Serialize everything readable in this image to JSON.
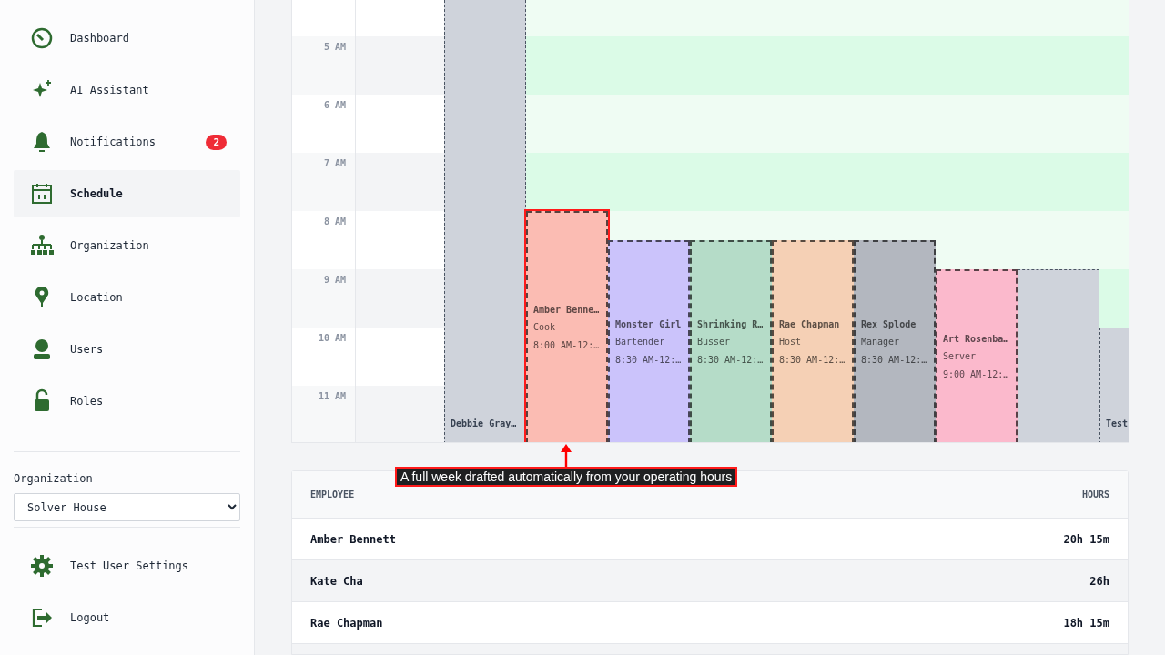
{
  "sidebar": {
    "items": [
      {
        "label": "Dashboard",
        "selected": false
      },
      {
        "label": "AI Assistant",
        "selected": false
      },
      {
        "label": "Notifications",
        "selected": false,
        "badge": "2"
      },
      {
        "label": "Schedule",
        "selected": true
      },
      {
        "label": "Organization",
        "selected": false
      },
      {
        "label": "Location",
        "selected": false
      },
      {
        "label": "Users",
        "selected": false
      },
      {
        "label": "Roles",
        "selected": false
      }
    ],
    "organization": {
      "label": "Organization",
      "value": "Solver House"
    },
    "footer_items": [
      {
        "label": "Test User Settings"
      },
      {
        "label": "Logout"
      }
    ]
  },
  "calendar": {
    "hours": [
      "5 AM",
      "6 AM",
      "7 AM",
      "8 AM",
      "9 AM",
      "10 AM",
      "11 AM"
    ],
    "events": [
      {
        "kind": "time-off",
        "name": "Debbie Gray…",
        "highlighted": false
      },
      {
        "kind": "shift",
        "name": "Amber Benne…",
        "role": "Cook",
        "time": "8:00 AM-12:…",
        "color": "#fbbcb3",
        "highlighted": true
      },
      {
        "kind": "shift",
        "name": "Monster Girl",
        "role": "Bartender",
        "time": "8:30 AM-12:…",
        "color": "#cbc3fb",
        "highlighted": false
      },
      {
        "kind": "shift",
        "name": "Shrinking R…",
        "role": "Busser",
        "time": "8:30 AM-12:…",
        "color": "#b5dcc8",
        "highlighted": false
      },
      {
        "kind": "shift",
        "name": "Rae Chapman",
        "role": "Host",
        "time": "8:30 AM-12:…",
        "color": "#f5d0b5",
        "highlighted": false
      },
      {
        "kind": "shift",
        "name": "Rex Splode",
        "role": "Manager",
        "time": "8:30 AM-12:…",
        "color": "#b3b7bf",
        "highlighted": false
      },
      {
        "kind": "shift",
        "name": "Art Rosenba…",
        "role": "Server",
        "time": "9:00 AM-12:…",
        "color": "#fbb9cc",
        "highlighted": false
      },
      {
        "kind": "time-off",
        "highlighted": false
      },
      {
        "kind": "time-off",
        "name": "Test",
        "highlighted": false
      }
    ]
  },
  "annotation": {
    "text": "A full week drafted automatically from your operating hours"
  },
  "hours_table": {
    "columns": [
      "EMPLOYEE",
      "HOURS"
    ],
    "rows": [
      {
        "employee": "Amber Bennett",
        "hours": "20h 15m"
      },
      {
        "employee": "Kate Cha",
        "hours": "26h"
      },
      {
        "employee": "Rae Chapman",
        "hours": "18h 15m"
      }
    ]
  }
}
